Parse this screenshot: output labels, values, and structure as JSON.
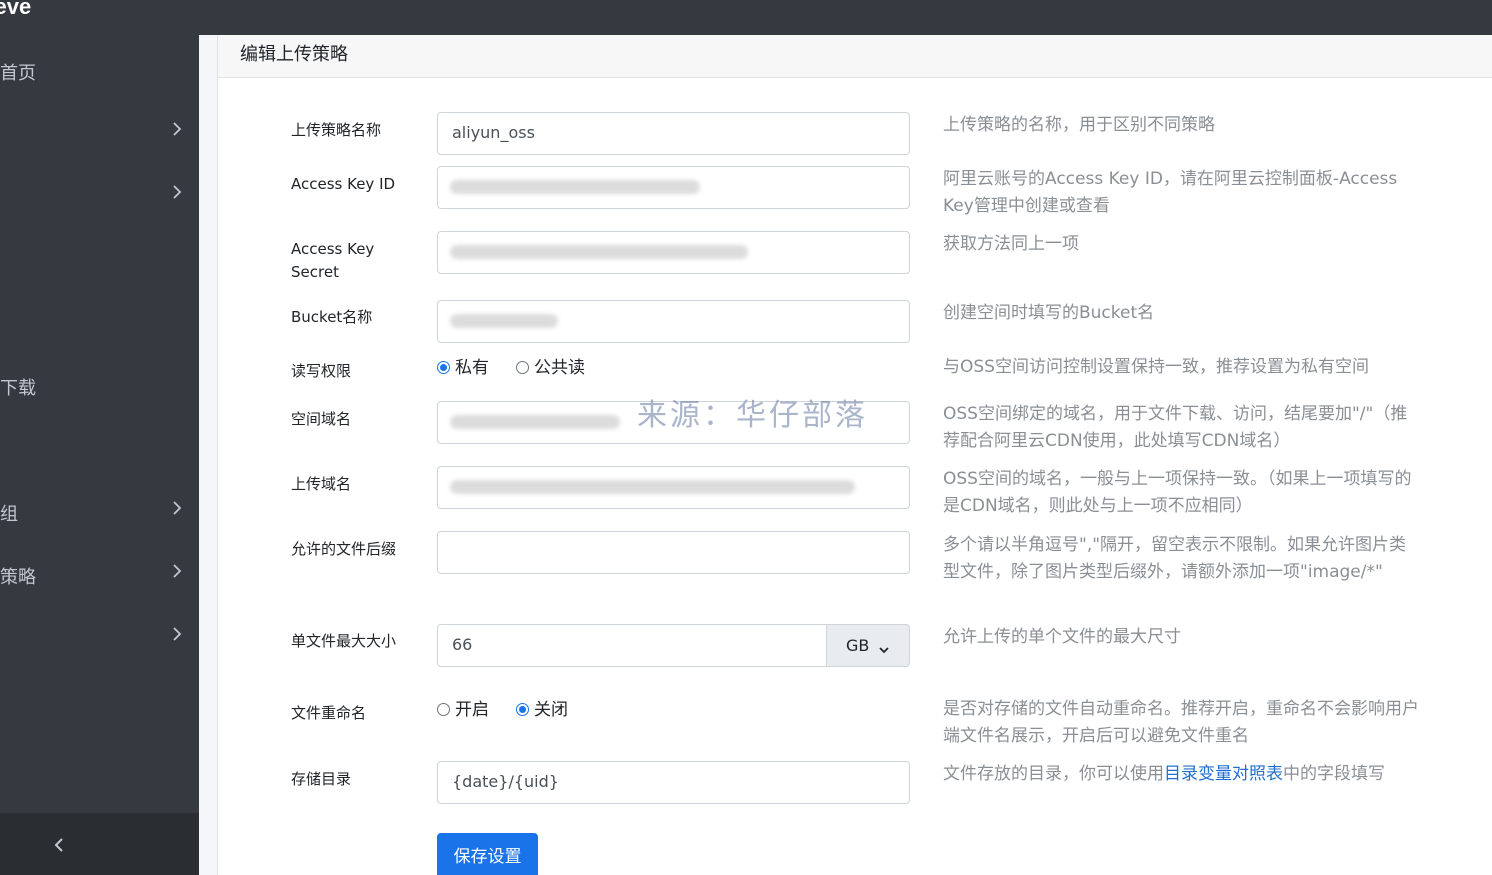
{
  "app": {
    "brand": "reve"
  },
  "sidebar": {
    "items": [
      {
        "label": "首页",
        "has_arrow": false
      },
      {
        "label": "",
        "has_arrow": true
      },
      {
        "label": "",
        "has_arrow": true
      },
      {
        "label": "下载",
        "has_arrow": false
      },
      {
        "label": "组",
        "has_arrow": true
      },
      {
        "label": "策略",
        "has_arrow": true
      },
      {
        "label": "",
        "has_arrow": true
      }
    ],
    "collapse_icon": "chevron-left-icon"
  },
  "page": {
    "title": "编辑上传策略"
  },
  "form": {
    "name": {
      "label": "上传策略名称",
      "value": "aliyun_oss",
      "help": "上传策略的名称，用于区别不同策略"
    },
    "access_key_id": {
      "label": "Access Key ID",
      "help": "阿里云账号的Access Key ID，请在阿里云控制面板-Access Key管理中创建或查看"
    },
    "access_key_secret": {
      "label": "Access Key Secret",
      "help": "获取方法同上一项"
    },
    "bucket": {
      "label": "Bucket名称",
      "help": "创建空间时填写的Bucket名"
    },
    "permission": {
      "label": "读写权限",
      "options": [
        "私有",
        "公共读"
      ],
      "selected": 0,
      "help": "与OSS空间访问控制设置保持一致，推荐设置为私有空间"
    },
    "space_domain": {
      "label": "空间域名",
      "help": "OSS空间绑定的域名，用于文件下载、访问，结尾要加\"/\"（推荐配合阿里云CDN使用，此处填写CDN域名）"
    },
    "upload_domain": {
      "label": "上传域名",
      "help": "OSS空间的域名，一般与上一项保持一致。（如果上一项填写的是CDN域名，则此处与上一项不应相同）"
    },
    "allowed_ext": {
      "label": "允许的文件后缀",
      "value": "",
      "help": "多个请以半角逗号\",\"隔开，留空表示不限制。如果允许图片类型文件，除了图片类型后缀外，请额外添加一项\"image/*\""
    },
    "max_size": {
      "label": "单文件最大大小",
      "value": "66",
      "unit": "GB",
      "help": "允许上传的单个文件的最大尺寸"
    },
    "rename": {
      "label": "文件重命名",
      "options": [
        "开启",
        "关闭"
      ],
      "selected": 1,
      "help": "是否对存储的文件自动重命名。推荐开启，重命名不会影响用户端文件名展示，开启后可以避免文件重名"
    },
    "directory": {
      "label": "存储目录",
      "value": "{date}/{uid}",
      "help_prefix": "文件存放的目录，你可以使用",
      "help_link": "目录变量对照表",
      "help_suffix": "中的字段填写"
    },
    "save_label": "保存设置"
  },
  "watermark": "来源：华仔部落"
}
